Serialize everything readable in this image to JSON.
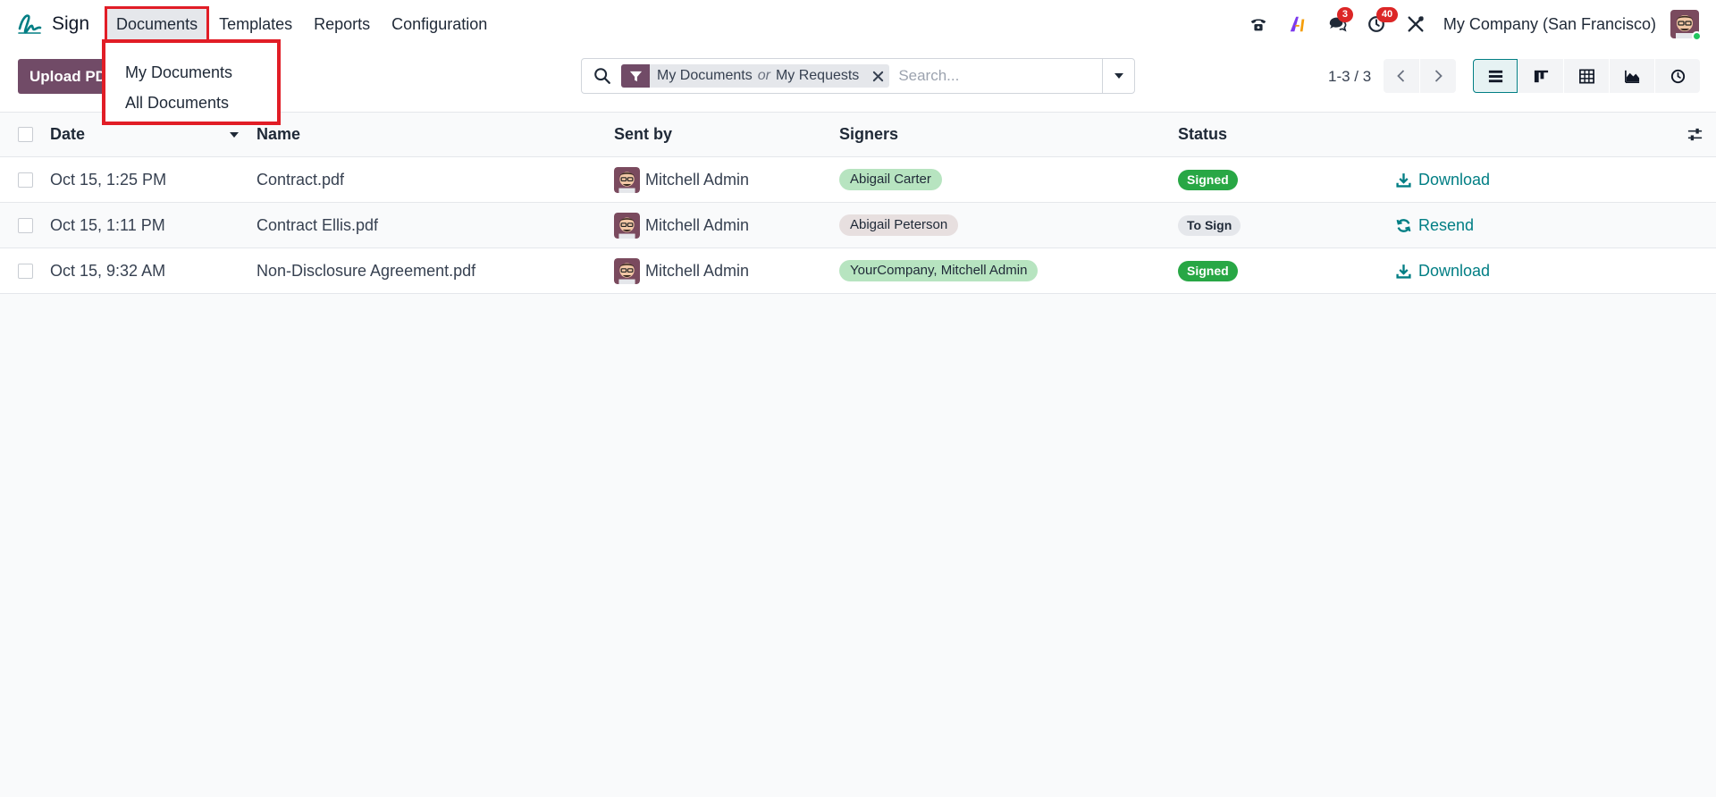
{
  "navbar": {
    "app_name": "Sign",
    "menu": [
      "Documents",
      "Templates",
      "Reports",
      "Configuration"
    ],
    "badges": {
      "messages": "3",
      "activities": "40"
    },
    "company": "My Company (San Francisco)"
  },
  "dropdown": {
    "items": [
      "My Documents",
      "All Documents"
    ]
  },
  "control": {
    "upload_label": "Upload PDF",
    "facet": {
      "first": "My Documents",
      "or": "or",
      "second": "My Requests"
    },
    "search_placeholder": "Search...",
    "pager": "1-3 / 3"
  },
  "table": {
    "headers": {
      "date": "Date",
      "name": "Name",
      "sent_by": "Sent by",
      "signers": "Signers",
      "status": "Status"
    },
    "rows": [
      {
        "date": "Oct 15, 1:25 PM",
        "name": "Contract.pdf",
        "sent_by": "Mitchell Admin",
        "signers": "Abigail Carter",
        "signer_color": "green",
        "status": "Signed",
        "status_kind": "signed",
        "action": "Download",
        "action_icon": "download-icon"
      },
      {
        "date": "Oct 15, 1:11 PM",
        "name": "Contract Ellis.pdf",
        "sent_by": "Mitchell Admin",
        "signers": "Abigail Peterson",
        "signer_color": "grey",
        "status": "To Sign",
        "status_kind": "tosign",
        "action": "Resend",
        "action_icon": "refresh-icon"
      },
      {
        "date": "Oct 15, 9:32 AM",
        "name": "Non-Disclosure Agreement.pdf",
        "sent_by": "Mitchell Admin",
        "signers": "YourCompany, Mitchell Admin",
        "signer_color": "green",
        "status": "Signed",
        "status_kind": "signed",
        "action": "Download",
        "action_icon": "download-icon"
      }
    ]
  },
  "colors": {
    "brand": "#714b67",
    "accent": "#017e84",
    "signed": "#28a745",
    "highlight": "#e11d26"
  }
}
